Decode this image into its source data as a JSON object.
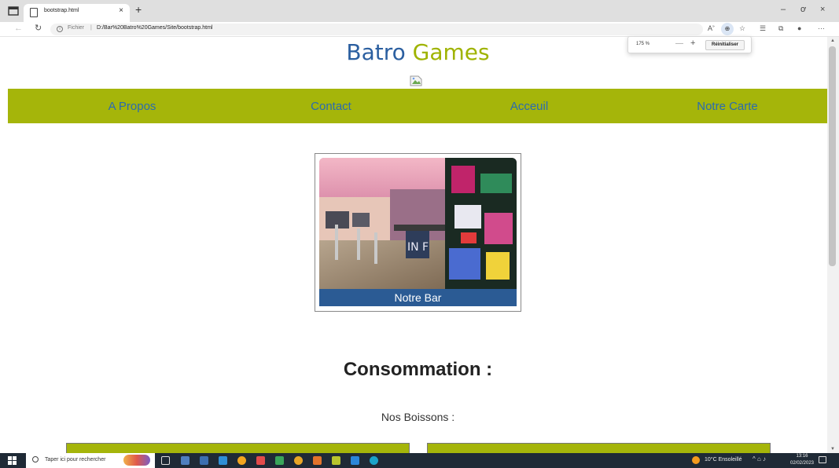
{
  "browser": {
    "tab_title": "bootstrap.html",
    "tab_close": "×",
    "new_tab": "+",
    "url_prefix": "Fichier",
    "url_sep": "|",
    "url": "D:/Bar%20Batro%20Games/Site/bootstrap.html",
    "window_buttons": {
      "minimize": "–",
      "restore": "ơ",
      "close": "×"
    }
  },
  "zoom_popup": {
    "level": "175 %",
    "minus": "—",
    "plus": "+",
    "reset_label": "Réinitialiser"
  },
  "site": {
    "title_part1": "Batro",
    "title_part2": "Games",
    "nav": [
      "A Propos",
      "Contact",
      "Acceuil",
      "Notre Carte"
    ],
    "bar_caption": "Notre Bar",
    "section_title": "Consommation :",
    "section_subtitle": "Nos Boissons :"
  },
  "taskbar": {
    "search_placeholder": "Taper ici pour rechercher",
    "weather": "10°C Ensoleillé",
    "time": "13:16",
    "date": "02/02/2023"
  },
  "colors": {
    "brand_blue": "#2b5fa0",
    "brand_green": "#9fb300",
    "navbar_bg": "#a5b50a",
    "caption_bg": "#2b5b94"
  }
}
